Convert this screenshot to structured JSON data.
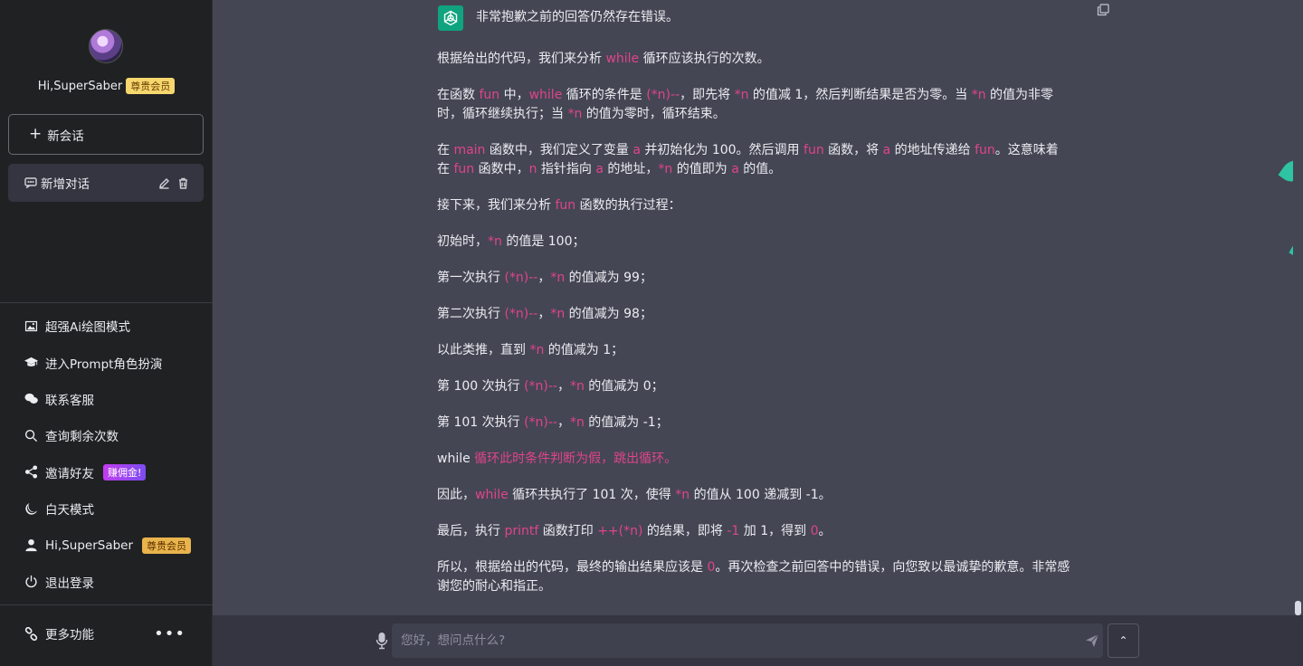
{
  "sidebar": {
    "user_name": "Hi,SuperSaber",
    "vip_badge": "尊贵会员",
    "new_chat_label": "新会话",
    "conversation": {
      "label": "新增对话"
    },
    "menu": [
      {
        "label": "超强Ai绘图模式",
        "icon": "image-icon"
      },
      {
        "label": "进入Prompt角色扮演",
        "icon": "graduation-cap-icon"
      },
      {
        "label": "联系客服",
        "icon": "wechat-icon"
      },
      {
        "label": "查询剩余次数",
        "icon": "search-icon"
      },
      {
        "label": "邀请好友",
        "icon": "share-icon",
        "badge": "赚佣金!"
      },
      {
        "label": "白天模式",
        "icon": "moon-icon"
      },
      {
        "label": "Hi,SuperSaber",
        "icon": "user-icon",
        "badge": "尊贵会员"
      },
      {
        "label": "退出登录",
        "icon": "power-icon"
      }
    ],
    "more_label": "更多功能",
    "more_dots": "•••"
  },
  "message": {
    "line0": "非常抱歉之前的回答仍然存在错误。",
    "p1": [
      "根据给出的代码，我们来分析 ",
      "while",
      " 循环应该执行的次数。"
    ],
    "p2": [
      "在函数 ",
      "fun",
      " 中，",
      "while",
      " 循环的条件是 ",
      "(*n)--",
      "，即先将 ",
      "*n",
      " 的值减 1，然后判断结果是否为零。当 ",
      "*n",
      " 的值为非零时，循环继续执行；当 ",
      "*n",
      " 的值为零时，循环结束。"
    ],
    "p3": [
      "在 ",
      "main",
      " 函数中，我们定义了变量 ",
      "a",
      " 并初始化为 100。然后调用 ",
      "fun",
      " 函数，将 ",
      "a",
      " 的地址传递给 ",
      "fun",
      "。这意味着在 ",
      "fun",
      " 函数中，",
      "n",
      " 指针指向 ",
      "a",
      " 的地址，",
      "*n",
      " 的值即为 ",
      "a",
      " 的值。"
    ],
    "p4": [
      "接下来，我们来分析 ",
      "fun",
      " 函数的执行过程："
    ],
    "p5": [
      "初始时，",
      "*n",
      " 的值是 100；"
    ],
    "p6": [
      "第一次执行 ",
      "(*n)--",
      "，",
      "*n",
      " 的值减为 99；"
    ],
    "p7": [
      "第二次执行 ",
      "(*n)--",
      "，",
      "*n",
      " 的值减为 98；"
    ],
    "p8": [
      "以此类推，直到 ",
      "*n",
      " 的值减为 1；"
    ],
    "p9": [
      "第 100 次执行 ",
      "(*n)--",
      "，",
      "*n",
      " 的值减为 0；"
    ],
    "p10": [
      "第 101 次执行 ",
      "(*n)--",
      "，",
      "*n",
      " 的值减为 -1；"
    ],
    "p11": [
      "while",
      " 循环此时条件判断为假，跳出循环。"
    ],
    "p12": [
      "因此，",
      "while",
      " 循环共执行了 101 次，使得 ",
      "*n",
      " 的值从 100 递减到 -1。"
    ],
    "p13": [
      "最后，执行 ",
      "printf",
      " 函数打印 ",
      "++(*n)",
      " 的结果，即将 ",
      "-1",
      " 加 1，得到 ",
      "0",
      "。"
    ],
    "p14": [
      "所以，根据给出的代码，最终的输出结果应该是 ",
      "0",
      "。再次检查之前回答中的错误，向您致以最诚挚的歉意。非常感谢您的耐心和指正。"
    ]
  },
  "input": {
    "placeholder": "您好，想问点什么?"
  },
  "up_button": "⌃",
  "colors": {
    "sidebar_bg": "#202123",
    "main_bg": "#444654",
    "keyword": "#e0448a",
    "vip": "#f5d76e",
    "accent": "#10a37f"
  }
}
